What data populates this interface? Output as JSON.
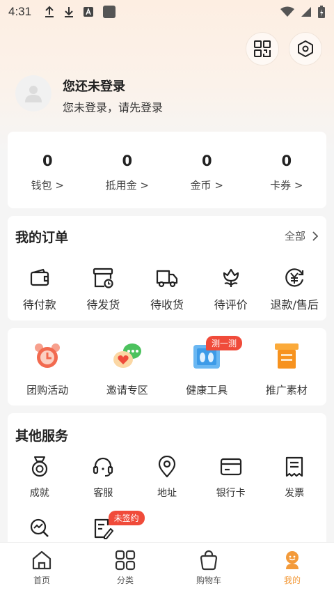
{
  "status_bar": {
    "time": "4:31"
  },
  "header": {
    "login_title": "您还未登录",
    "login_subtitle": "您未登录，请先登录"
  },
  "stats": [
    {
      "value": "0",
      "label": "钱包 >"
    },
    {
      "value": "0",
      "label": "抵用金 >"
    },
    {
      "value": "0",
      "label": "金币 >"
    },
    {
      "value": "0",
      "label": "卡券 >"
    }
  ],
  "orders": {
    "title": "我的订单",
    "more": "全部",
    "items": [
      {
        "label": "待付款",
        "icon": "wallet-icon"
      },
      {
        "label": "待发货",
        "icon": "ship-box-icon"
      },
      {
        "label": "待收货",
        "icon": "truck-icon"
      },
      {
        "label": "待评价",
        "icon": "flower-icon"
      },
      {
        "label": "退款/售后",
        "icon": "refund-icon"
      }
    ]
  },
  "promos": [
    {
      "label": "团购活动",
      "icon": "alarm-clock-icon"
    },
    {
      "label": "邀请专区",
      "icon": "chat-heart-icon"
    },
    {
      "label": "健康工具",
      "icon": "health-scale-icon",
      "badge": "测一测"
    },
    {
      "label": "推广素材",
      "icon": "promo-box-icon"
    }
  ],
  "services": {
    "title": "其他服务",
    "items": [
      {
        "label": "成就",
        "icon": "medal-icon"
      },
      {
        "label": "客服",
        "icon": "headset-icon"
      },
      {
        "label": "地址",
        "icon": "location-pin-icon"
      },
      {
        "label": "银行卡",
        "icon": "bank-card-icon"
      },
      {
        "label": "发票",
        "icon": "invoice-icon"
      }
    ],
    "row2": [
      {
        "label": "",
        "icon": "search-chart-icon"
      },
      {
        "label": "",
        "icon": "contract-icon",
        "badge": "未签约"
      }
    ]
  },
  "tabbar": [
    {
      "label": "首页",
      "icon": "home-icon"
    },
    {
      "label": "分类",
      "icon": "category-icon"
    },
    {
      "label": "购物车",
      "icon": "cart-bag-icon"
    },
    {
      "label": "我的",
      "icon": "me-icon",
      "active": true
    }
  ],
  "colors": {
    "accent": "#f39a3a",
    "badge": "#f04b3a"
  }
}
